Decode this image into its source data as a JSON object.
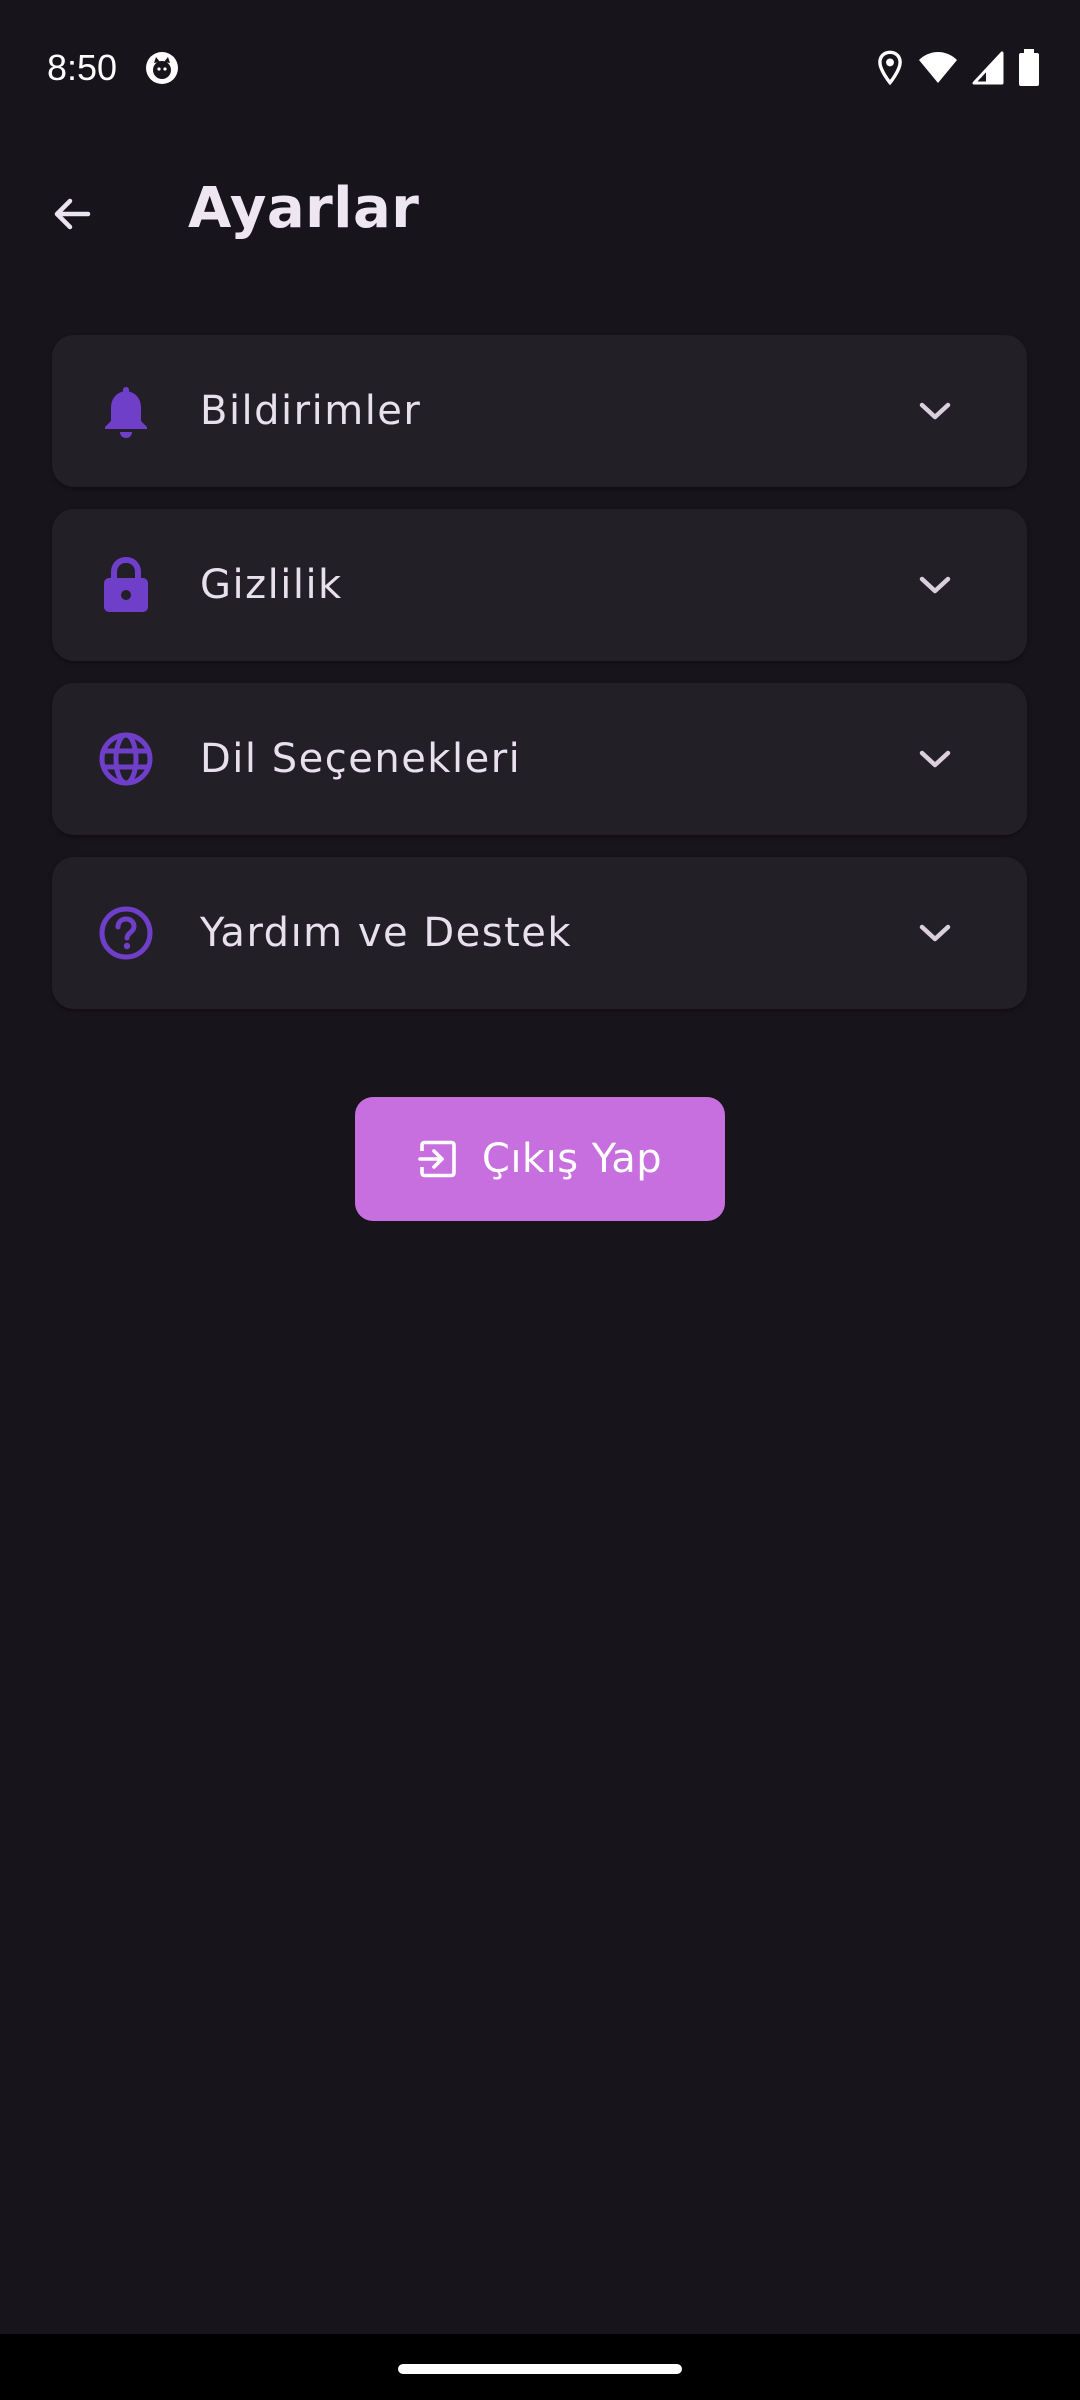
{
  "status_bar": {
    "time": "8:50"
  },
  "app_bar": {
    "title": "Ayarlar"
  },
  "settings": {
    "accent_color": "#6f3fc9",
    "items": [
      {
        "label": "Bildirimler",
        "icon": "bell-icon"
      },
      {
        "label": "Gizlilik",
        "icon": "lock-icon"
      },
      {
        "label": "Dil Seçenekleri",
        "icon": "globe-icon"
      },
      {
        "label": "Yardım ve Destek",
        "icon": "help-circle-icon"
      }
    ]
  },
  "logout": {
    "label": "Çıkış Yap",
    "icon": "logout-icon",
    "color": "#c86fe0"
  }
}
